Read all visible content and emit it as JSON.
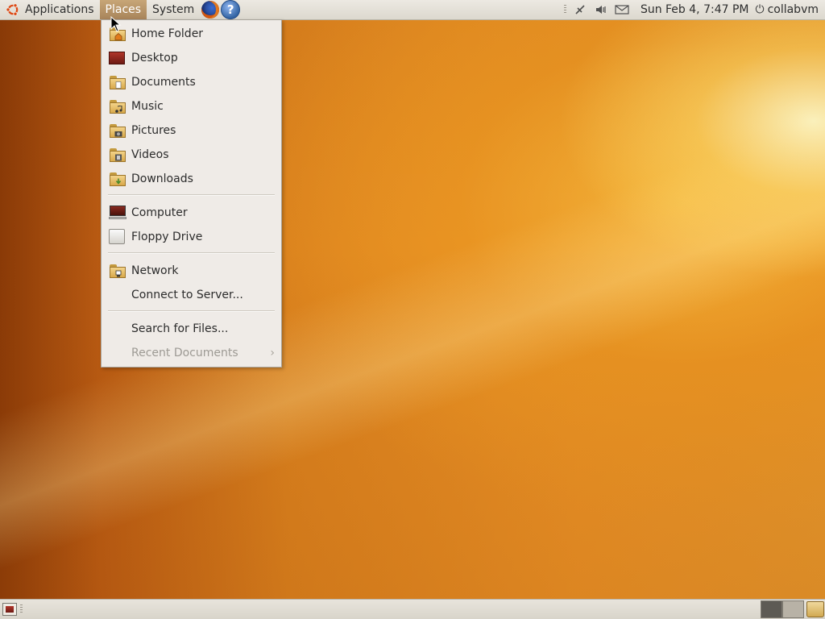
{
  "top_panel": {
    "menus": {
      "applications": "Applications",
      "places": "Places",
      "system": "System"
    },
    "launchers": {
      "firefox": "firefox-icon",
      "help": "?"
    },
    "tray": {
      "network_icon": "network-disconnected-icon",
      "volume_icon": "volume-icon",
      "mail_icon": "mail-icon"
    },
    "clock": "Sun Feb  4,  7:47 PM",
    "user": "collabvm"
  },
  "places_menu": {
    "items": [
      {
        "label": "Home Folder",
        "icon": "home-folder-icon"
      },
      {
        "label": "Desktop",
        "icon": "desktop-icon"
      },
      {
        "label": "Documents",
        "icon": "documents-folder-icon"
      },
      {
        "label": "Music",
        "icon": "music-folder-icon"
      },
      {
        "label": "Pictures",
        "icon": "pictures-folder-icon"
      },
      {
        "label": "Videos",
        "icon": "videos-folder-icon"
      },
      {
        "label": "Downloads",
        "icon": "downloads-folder-icon"
      },
      {
        "label": "Computer",
        "icon": "computer-icon"
      },
      {
        "label": "Floppy Drive",
        "icon": "floppy-drive-icon"
      },
      {
        "label": "Network",
        "icon": "network-folder-icon"
      },
      {
        "label": "Connect to Server...",
        "icon": ""
      },
      {
        "label": "Search for Files...",
        "icon": ""
      },
      {
        "label": "Recent Documents",
        "icon": "",
        "disabled": true,
        "submenu": true
      }
    ],
    "submenu_arrow": "›"
  },
  "bottom_panel": {
    "workspaces": 2,
    "active_workspace": 1
  },
  "colors": {
    "panel": "#dedad1",
    "menu_bg": "#efebe7",
    "active_menu": "#b4936a",
    "disabled_text": "#9d9a94"
  }
}
